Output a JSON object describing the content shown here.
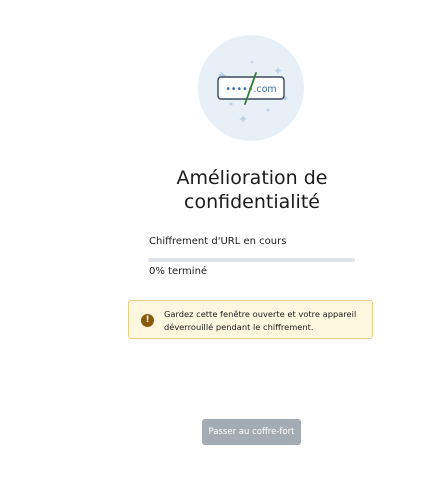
{
  "illustration": {
    "icon": "masked-url-icon",
    "url_text": "•••••.com"
  },
  "title": "Amélioration de confidentialité",
  "progress": {
    "label": "Chiffrement d'URL en cours",
    "percent": 0,
    "text": "0% terminé"
  },
  "warning": {
    "icon": "warning-icon",
    "text": "Gardez cette fenêtre ouverte et votre appareil déverrouillé pendant le chiffrement."
  },
  "skip_button": {
    "label": "Passer au coffre-fort",
    "enabled": false
  },
  "colors": {
    "accent": "#1e88e5",
    "illustration_bg": "#e7eff7",
    "warning_bg": "#fef7e0",
    "warning_border": "#e9cf86",
    "warning_icon": "#8a5a0b",
    "button_disabled": "#a3abb4"
  }
}
